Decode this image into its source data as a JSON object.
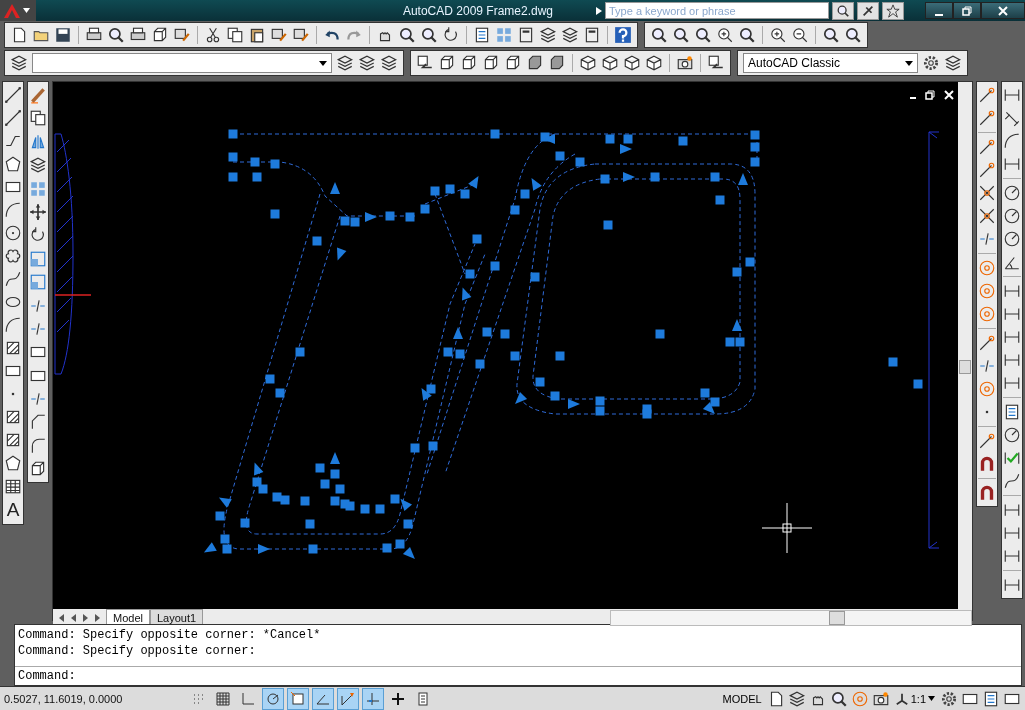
{
  "window": {
    "title": "AutoCAD 2009 Frame2.dwg"
  },
  "search": {
    "placeholder": "Type a keyword or phrase"
  },
  "workspace": {
    "value": "AutoCAD Classic"
  },
  "draw_toolbar": {
    "text_glyph": "A"
  },
  "layout_tabs": [
    {
      "label": "Model",
      "selected": true
    },
    {
      "label": "Layout1",
      "selected": false
    }
  ],
  "command_history": [
    "Command: Specify opposite corner: *Cancel*",
    "Command: Specify opposite corner:"
  ],
  "command_prompt": "Command:",
  "status_bar": {
    "coordinates": "0.5027, 11.6019, 0.0000",
    "toggles": [
      {
        "kind": "snap",
        "on": false
      },
      {
        "kind": "grid",
        "on": false
      },
      {
        "kind": "ortho",
        "on": false
      },
      {
        "kind": "polar",
        "on": true
      },
      {
        "kind": "osnap",
        "on": true
      },
      {
        "kind": "otrack",
        "on": true
      },
      {
        "kind": "ducs",
        "on": true
      },
      {
        "kind": "dyn",
        "on": true
      },
      {
        "kind": "lweight",
        "on": false
      },
      {
        "kind": "qp",
        "on": false
      }
    ],
    "space": "MODEL",
    "annotation_scale": "1:1"
  }
}
